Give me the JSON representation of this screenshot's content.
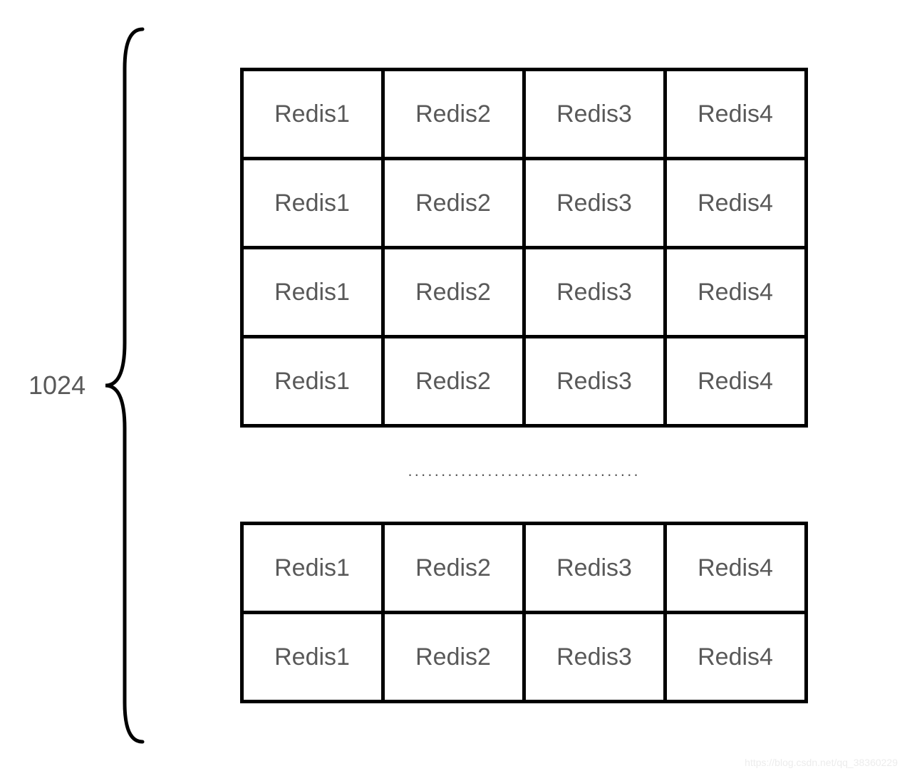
{
  "size_label": "1024",
  "top_table": [
    [
      "Redis1",
      "Redis2",
      "Redis3",
      "Redis4"
    ],
    [
      "Redis1",
      "Redis2",
      "Redis3",
      "Redis4"
    ],
    [
      "Redis1",
      "Redis2",
      "Redis3",
      "Redis4"
    ],
    [
      "Redis1",
      "Redis2",
      "Redis3",
      "Redis4"
    ]
  ],
  "bottom_table": [
    [
      "Redis1",
      "Redis2",
      "Redis3",
      "Redis4"
    ],
    [
      "Redis1",
      "Redis2",
      "Redis3",
      "Redis4"
    ]
  ],
  "ellipsis": "···································",
  "watermark": "https://blog.csdn.net/qq_38360229"
}
